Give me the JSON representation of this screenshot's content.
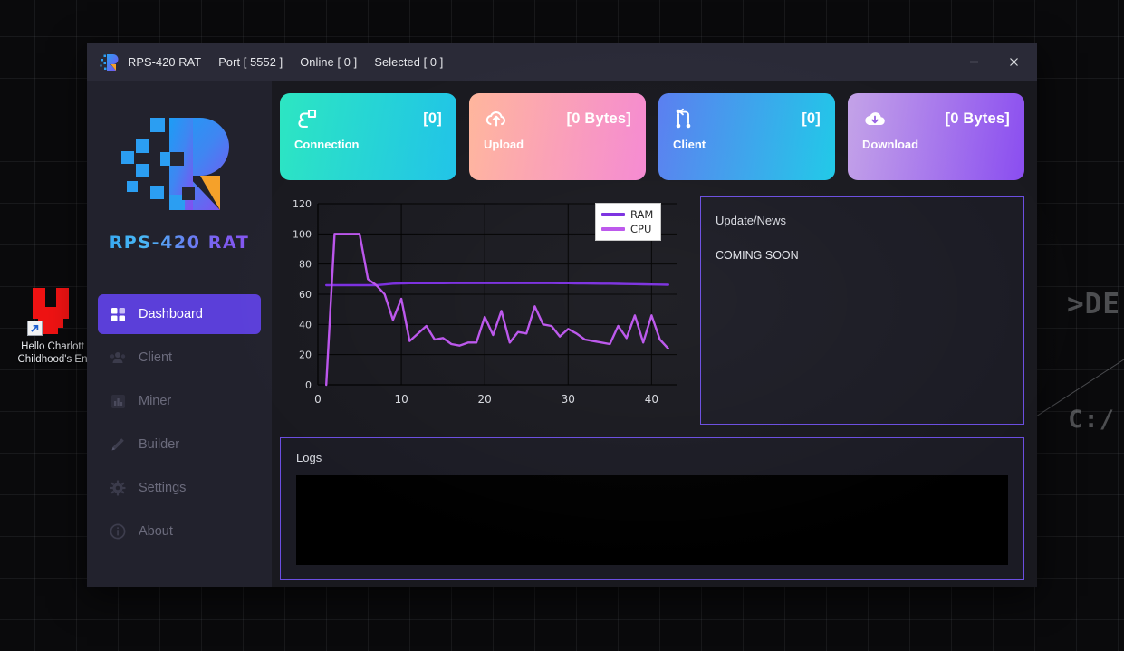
{
  "desktop": {
    "wallpaper_text_1": ">DE",
    "wallpaper_text_2": "C:/",
    "icon": {
      "name": "hello-charlotte-shortcut",
      "label_line1": "Hello Charlott",
      "label_line2": "Childhood's En",
      "color": "#ef1313"
    }
  },
  "window": {
    "titlebar": {
      "app_name": "RPS-420 RAT",
      "port": "Port [ 5552 ]",
      "online": "Online [ 0 ]",
      "selected": "Selected [ 0 ]",
      "minimize": "minimize-icon",
      "close": "close-icon"
    },
    "sidebar": {
      "brand": "RPS-420 RAT",
      "accent": "#5b3fd9",
      "items": [
        {
          "label": "Dashboard",
          "icon": "grid-icon",
          "active": true
        },
        {
          "label": "Client",
          "icon": "users-icon",
          "active": false
        },
        {
          "label": "Miner",
          "icon": "bar-chart-icon",
          "active": false
        },
        {
          "label": "Builder",
          "icon": "pencil-icon",
          "active": false
        },
        {
          "label": "Settings",
          "icon": "gear-icon",
          "active": false
        },
        {
          "label": "About",
          "icon": "info-icon",
          "active": false
        }
      ]
    },
    "cards": [
      {
        "label": "Connection",
        "value": "[0]",
        "icon": "plug-icon",
        "from": "#2de6c2",
        "to": "#1fc3e8"
      },
      {
        "label": "Upload",
        "value": "[0 Bytes]",
        "icon": "cloud-upload-icon",
        "from": "#ffb69c",
        "to": "#f589d2"
      },
      {
        "label": "Client",
        "value": "[0]",
        "icon": "git-branch-icon",
        "from": "#5a7ef0",
        "to": "#1fc9e8"
      },
      {
        "label": "Download",
        "value": "[0 Bytes]",
        "icon": "cloud-download-icon",
        "from": "#c4a3e8",
        "to": "#8a4df0"
      }
    ],
    "news": {
      "title": "Update/News",
      "body": "COMING SOON",
      "border": "#6b4ee0"
    },
    "logs": {
      "title": "Logs",
      "content": "",
      "border": "#6b4ee0"
    }
  },
  "chart_data": {
    "type": "line",
    "title": "",
    "xlabel": "",
    "ylabel": "",
    "xlim": [
      0,
      43
    ],
    "ylim": [
      0,
      120
    ],
    "grid": true,
    "legend_position": "top-right",
    "xticks": [
      0,
      10,
      20,
      30,
      40
    ],
    "yticks": [
      0,
      20,
      40,
      60,
      80,
      100,
      120
    ],
    "x": [
      1,
      2,
      3,
      4,
      5,
      6,
      7,
      8,
      9,
      10,
      11,
      12,
      13,
      14,
      15,
      16,
      17,
      18,
      19,
      20,
      21,
      22,
      23,
      24,
      25,
      26,
      27,
      28,
      29,
      30,
      31,
      32,
      33,
      34,
      35,
      36,
      37,
      38,
      39,
      40,
      41,
      42
    ],
    "series": [
      {
        "name": "RAM",
        "color": "#7b2fe0",
        "values": [
          66,
          66,
          66,
          66,
          66,
          66,
          66,
          66.5,
          67,
          67.2,
          67.3,
          67.3,
          67.3,
          67.3,
          67.3,
          67.4,
          67.4,
          67.4,
          67.4,
          67.4,
          67.4,
          67.4,
          67.4,
          67.4,
          67.4,
          67.4,
          67.5,
          67.4,
          67.3,
          67.3,
          67.2,
          67.2,
          67.1,
          67,
          67,
          66.9,
          66.8,
          66.7,
          66.6,
          66.5,
          66.4,
          66.3
        ]
      },
      {
        "name": "CPU",
        "color": "#bb55ec",
        "values": [
          0,
          100,
          100,
          100,
          100,
          70,
          66,
          60,
          43,
          57,
          29,
          34,
          39,
          30,
          31,
          27,
          26,
          28,
          28,
          45,
          33,
          49,
          28,
          35,
          34,
          52,
          40,
          39,
          32,
          37,
          34,
          30,
          29,
          28,
          27,
          39,
          31,
          46,
          28,
          46,
          30,
          24
        ]
      }
    ]
  }
}
